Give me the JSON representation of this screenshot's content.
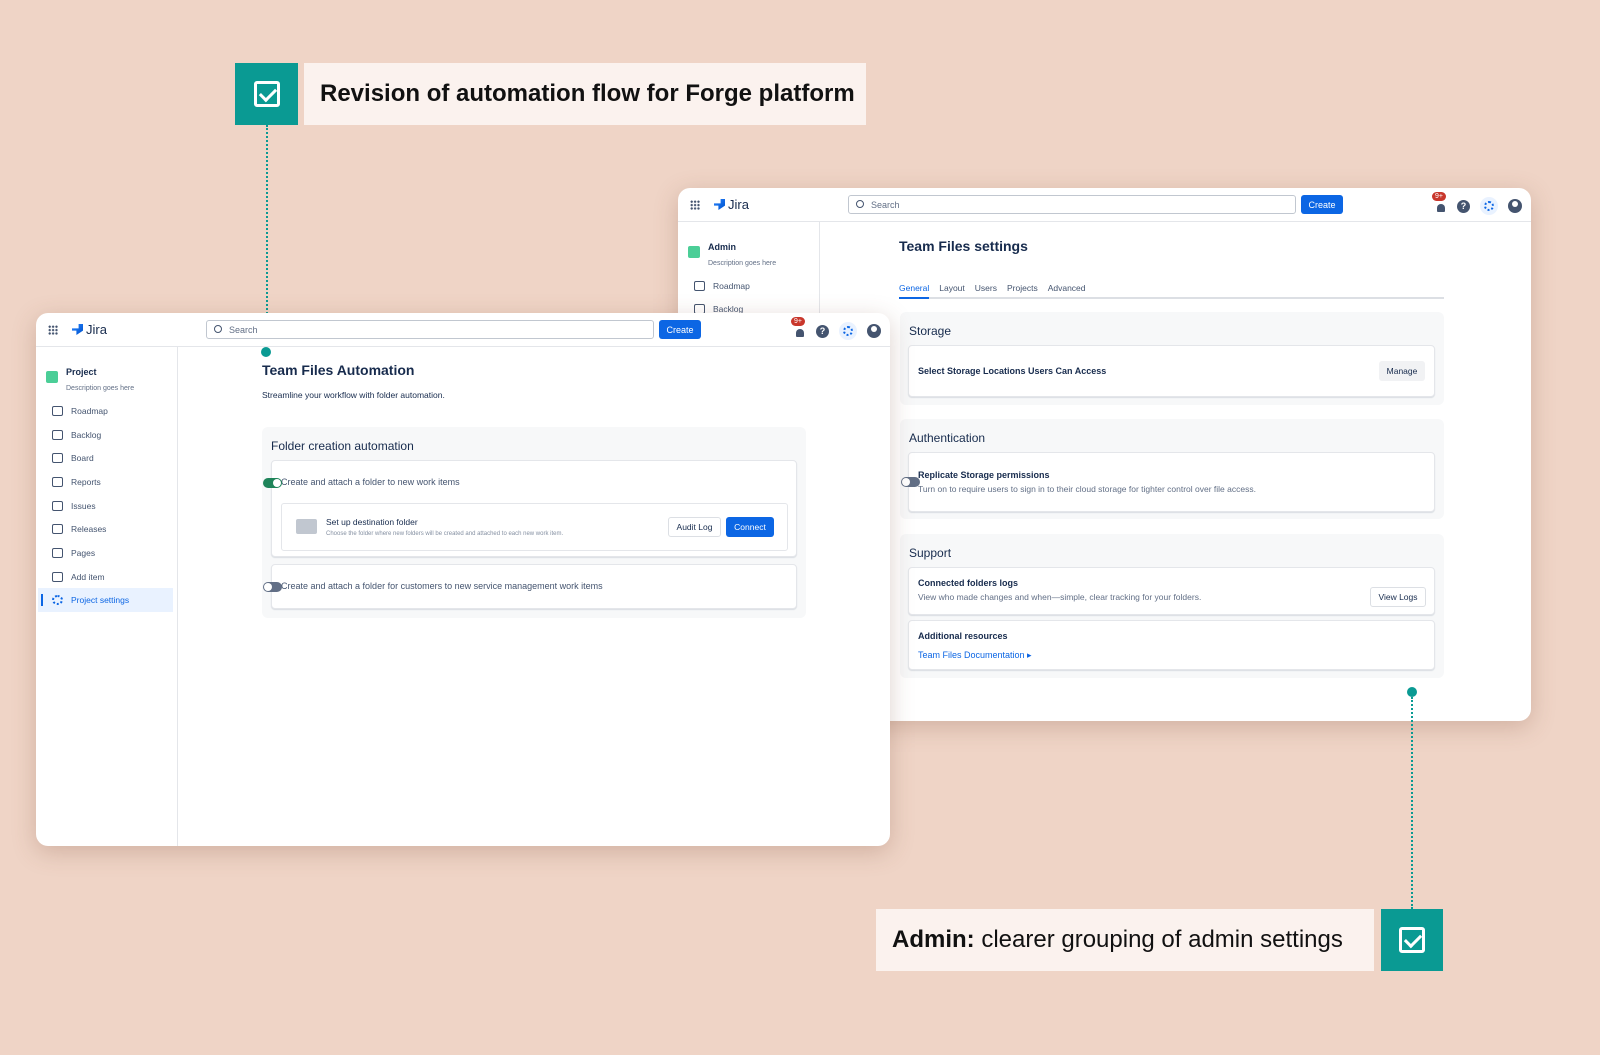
{
  "callouts": {
    "top": "Revision of automation flow for Forge platform",
    "bottom_bold": "Admin:",
    "bottom_rest": " clearer grouping of admin settings"
  },
  "colors": {
    "accent": "#0a9a93",
    "primary": "#0c66e4",
    "background": "#efd4c6"
  },
  "common": {
    "app": "Jira",
    "search_placeholder": "Search",
    "create": "Create",
    "badge": "9+"
  },
  "project_window": {
    "sidebar": {
      "title": "Project",
      "desc": "Description goes here",
      "items": [
        "Roadmap",
        "Backlog",
        "Board",
        "Reports",
        "Issues",
        "Releases",
        "Pages",
        "Add item",
        "Project settings"
      ]
    },
    "title": "Team Files Automation",
    "subtitle": "Streamline your workflow with folder automation.",
    "section": "Folder creation automation",
    "rule1": {
      "label": "Create and attach a folder to new work items",
      "enabled": true
    },
    "dest": {
      "title": "Set up destination folder",
      "desc": "Choose the folder where new folders will be created and attached to each new work item.",
      "audit": "Audit Log",
      "connect": "Connect"
    },
    "rule2": {
      "label": "Create and attach a folder for customers to new service management work items",
      "enabled": false
    }
  },
  "admin_window": {
    "sidebar": {
      "title": "Admin",
      "desc": "Description goes here",
      "items": [
        "Roadmap",
        "Backlog"
      ]
    },
    "title": "Team Files settings",
    "tabs": [
      "General",
      "Layout",
      "Users",
      "Projects",
      "Advanced"
    ],
    "active_tab": "General",
    "storage": {
      "heading": "Storage",
      "label": "Select Storage Locations Users Can Access",
      "button": "Manage"
    },
    "auth": {
      "heading": "Authentication",
      "label": "Replicate Storage permissions",
      "desc": "Turn on to require users to sign in to their cloud storage for tighter control over file access.",
      "enabled": false
    },
    "support": {
      "heading": "Support",
      "logs_label": "Connected folders logs",
      "logs_desc": "View who made changes and when—simple, clear tracking for your folders.",
      "logs_button": "View Logs",
      "res_label": "Additional resources",
      "res_link": "Team Files Documentation ▸"
    }
  }
}
